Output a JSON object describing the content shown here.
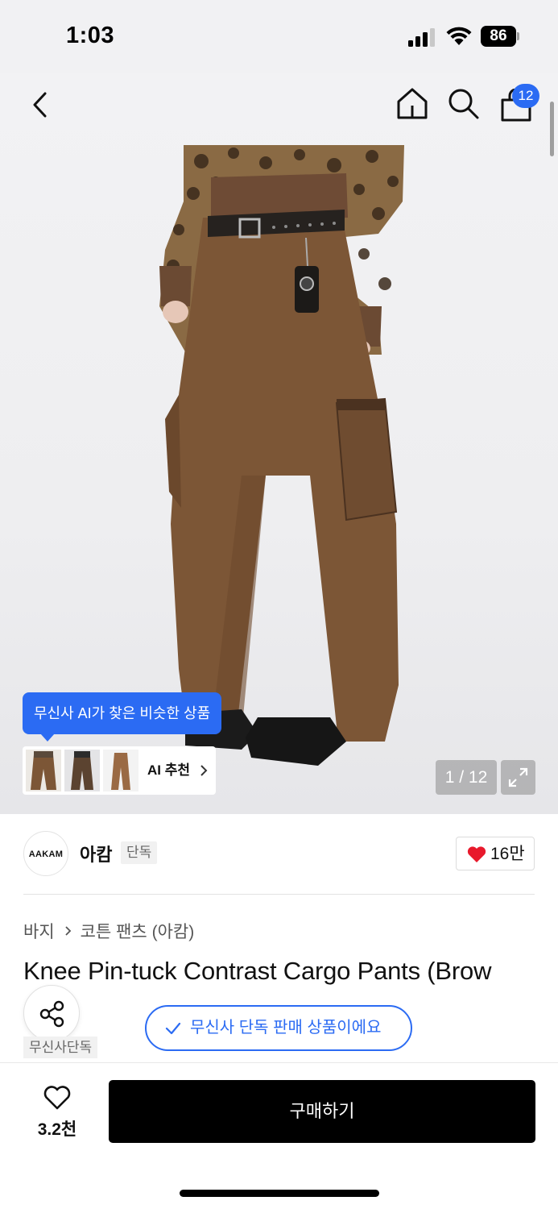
{
  "status_bar": {
    "time": "1:03",
    "battery": "86"
  },
  "nav": {
    "cart_count": "12"
  },
  "gallery": {
    "ai_tooltip": "무신사 AI가 찾은 비슷한 상품",
    "ai_label": "AI 추천",
    "page_counter": "1 / 12"
  },
  "brand": {
    "logo_text": "AAKAM",
    "name": "아캄",
    "exclusive_tag": "단독",
    "likes": "16만"
  },
  "breadcrumb": {
    "category": "바지",
    "subcategory": "코튼 팬츠 (아캄)"
  },
  "product": {
    "title": "Knee Pin-tuck Contrast Cargo Pants (Brow",
    "musinsa_exclusive_tag": "무신사단독",
    "exclusive_notice": "무신사 단독 판매 상품이에요"
  },
  "bottom_bar": {
    "wish_count": "3.2천",
    "buy_label": "구매하기"
  },
  "colors": {
    "accent": "#2b6bf3",
    "heart": "#e8192c",
    "buy_button": "#000000"
  },
  "icons": [
    "back-icon",
    "home-icon",
    "search-icon",
    "cart-icon",
    "expand-icon",
    "heart-icon",
    "share-icon",
    "check-icon",
    "chevron-right-icon"
  ]
}
